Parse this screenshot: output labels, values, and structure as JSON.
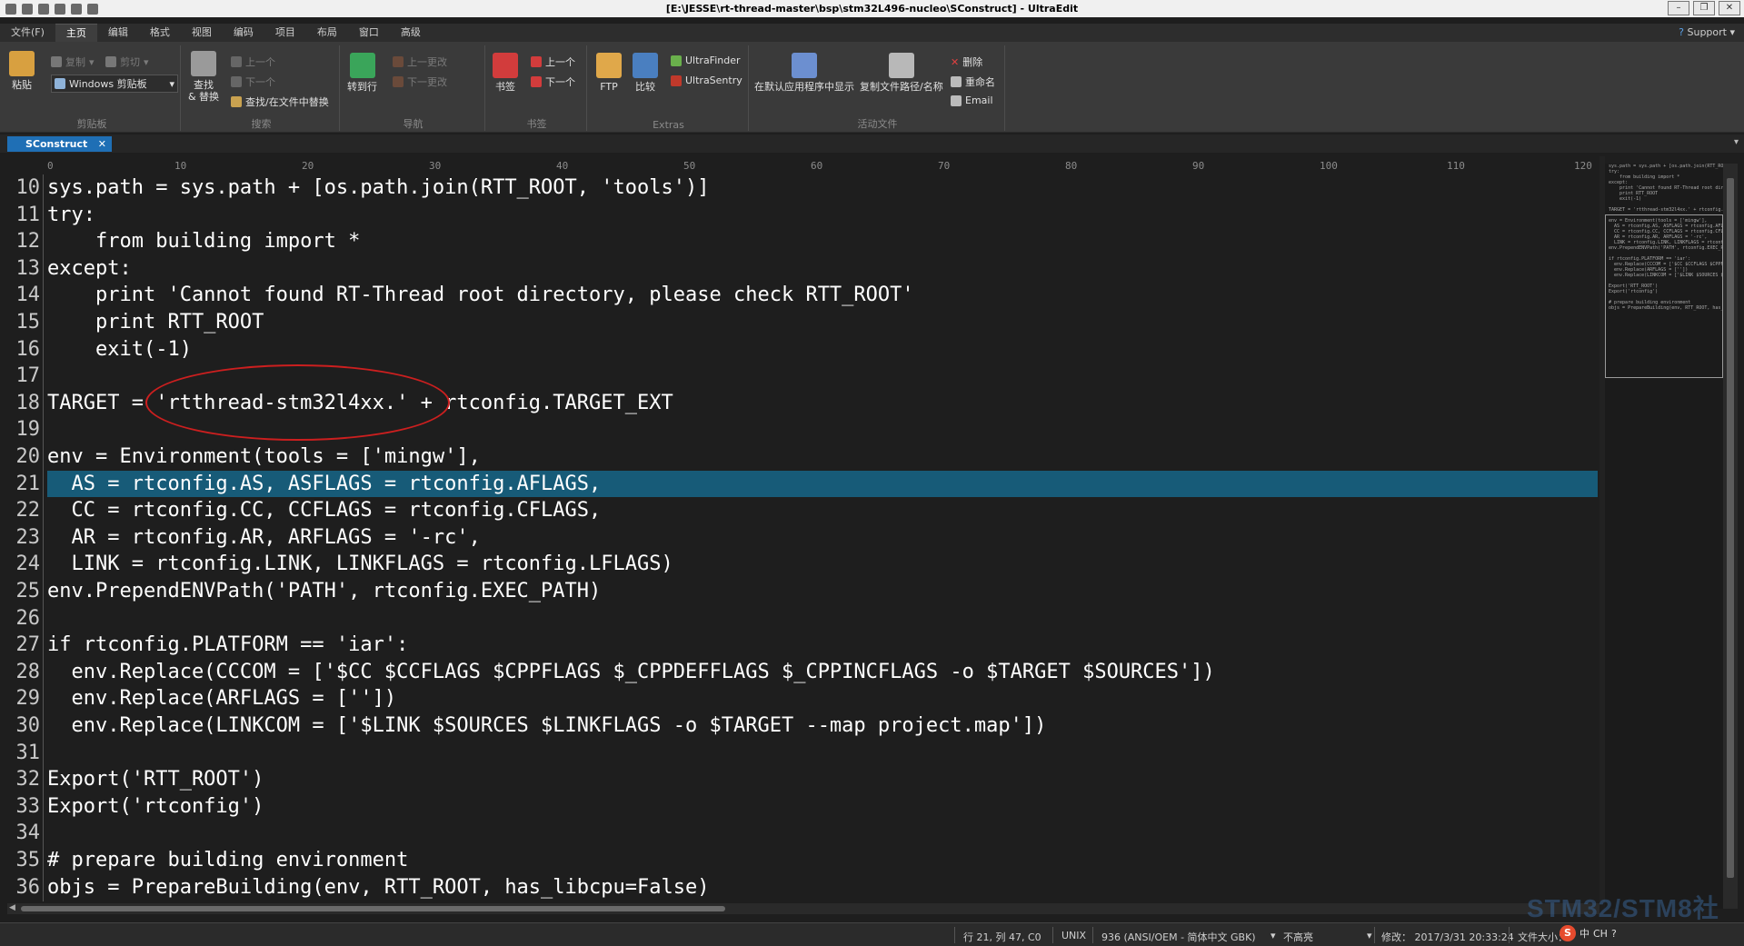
{
  "window": {
    "title": "[E:\\JESSE\\rt-thread-master\\bsp\\stm32L496-nucleo\\SConstruct] - UltraEdit",
    "controls": [
      "–",
      "❐",
      "✕"
    ]
  },
  "menu": {
    "tabs": [
      "文件(F)",
      "主页",
      "编辑",
      "格式",
      "视图",
      "编码",
      "项目",
      "布局",
      "窗口",
      "高级"
    ],
    "active_index": 1,
    "support": "Support"
  },
  "ribbon": {
    "clipboard": {
      "label": "剪贴板",
      "paste": "粘贴",
      "copy": "复制",
      "cut": "剪切",
      "clipboard_select": "Windows 剪贴板"
    },
    "search": {
      "label": "搜索",
      "find_replace": "查找\n& 替换",
      "prev": "上一个",
      "next": "下一个",
      "find_in_files": "查找/在文件中替换"
    },
    "nav": {
      "label": "导航",
      "goto": "转到行",
      "prev_change": "上一更改",
      "next_change": "下一更改"
    },
    "bookmarks": {
      "label": "书签",
      "bookmark": "书签",
      "prev": "上一个",
      "next": "下一个"
    },
    "extras": {
      "label": "Extras",
      "ftp": "FTP",
      "compare": "比较",
      "ultrafinder": "UltraFinder",
      "ultrasentry": "UltraSentry"
    },
    "active_file": {
      "label": "活动文件",
      "open_default": "在默认应用程序中显示",
      "copy_path": "复制文件路径/名称",
      "delete": "删除",
      "rename": "重命名",
      "email": "Email"
    }
  },
  "document": {
    "tab_name": "SConstruct",
    "ruler": [
      "0",
      "10",
      "20",
      "30",
      "40",
      "50",
      "60",
      "70",
      "80",
      "90",
      "100",
      "110",
      "120"
    ],
    "highlight_line": 21,
    "lines": [
      {
        "n": "10",
        "text": "sys.path = sys.path + [os.path.join(RTT_ROOT, 'tools')]"
      },
      {
        "n": "11",
        "text": "try:"
      },
      {
        "n": "12",
        "text": "    from building import *"
      },
      {
        "n": "13",
        "text": "except:"
      },
      {
        "n": "14",
        "text": "    print 'Cannot found RT-Thread root directory, please check RTT_ROOT'"
      },
      {
        "n": "15",
        "text": "    print RTT_ROOT"
      },
      {
        "n": "16",
        "text": "    exit(-1)"
      },
      {
        "n": "17",
        "text": ""
      },
      {
        "n": "18",
        "text": "TARGET = 'rtthread-stm32l4xx.' + rtconfig.TARGET_EXT"
      },
      {
        "n": "19",
        "text": ""
      },
      {
        "n": "20",
        "text": "env = Environment(tools = ['mingw'],"
      },
      {
        "n": "21",
        "text": "  AS = rtconfig.AS, ASFLAGS = rtconfig.AFLAGS,"
      },
      {
        "n": "22",
        "text": "  CC = rtconfig.CC, CCFLAGS = rtconfig.CFLAGS,"
      },
      {
        "n": "23",
        "text": "  AR = rtconfig.AR, ARFLAGS = '-rc',"
      },
      {
        "n": "24",
        "text": "  LINK = rtconfig.LINK, LINKFLAGS = rtconfig.LFLAGS)"
      },
      {
        "n": "25",
        "text": "env.PrependENVPath('PATH', rtconfig.EXEC_PATH)"
      },
      {
        "n": "26",
        "text": ""
      },
      {
        "n": "27",
        "text": "if rtconfig.PLATFORM == 'iar':"
      },
      {
        "n": "28",
        "text": "  env.Replace(CCCOM = ['$CC $CCFLAGS $CPPFLAGS $_CPPDEFFLAGS $_CPPINCFLAGS -o $TARGET $SOURCES'])"
      },
      {
        "n": "29",
        "text": "  env.Replace(ARFLAGS = [''])"
      },
      {
        "n": "30",
        "text": "  env.Replace(LINKCOM = ['$LINK $SOURCES $LINKFLAGS -o $TARGET --map project.map'])"
      },
      {
        "n": "31",
        "text": ""
      },
      {
        "n": "32",
        "text": "Export('RTT_ROOT')"
      },
      {
        "n": "33",
        "text": "Export('rtconfig')"
      },
      {
        "n": "34",
        "text": ""
      },
      {
        "n": "35",
        "text": "# prepare building environment"
      },
      {
        "n": "36",
        "text": "objs = PrepareBuilding(env, RTT_ROOT, has_libcpu=False)"
      }
    ]
  },
  "status": {
    "position": "行 21, 列 47, C0",
    "line_ending": "UNIX",
    "encoding": "936  (ANSI/OEM - 简体中文 GBK)",
    "highlight": "不高亮",
    "modified": "修改：  2017/3/31 20:33:24",
    "filesize": "文件大小："
  },
  "watermark": "STM32/STM8社区",
  "tray": {
    "ime": "S",
    "lang": "中",
    "items": [
      "CH",
      "?"
    ]
  },
  "colors": {
    "accent": "#1f6fb5",
    "highlight_line": "#175b78",
    "annotation": "#cc1f1f"
  }
}
